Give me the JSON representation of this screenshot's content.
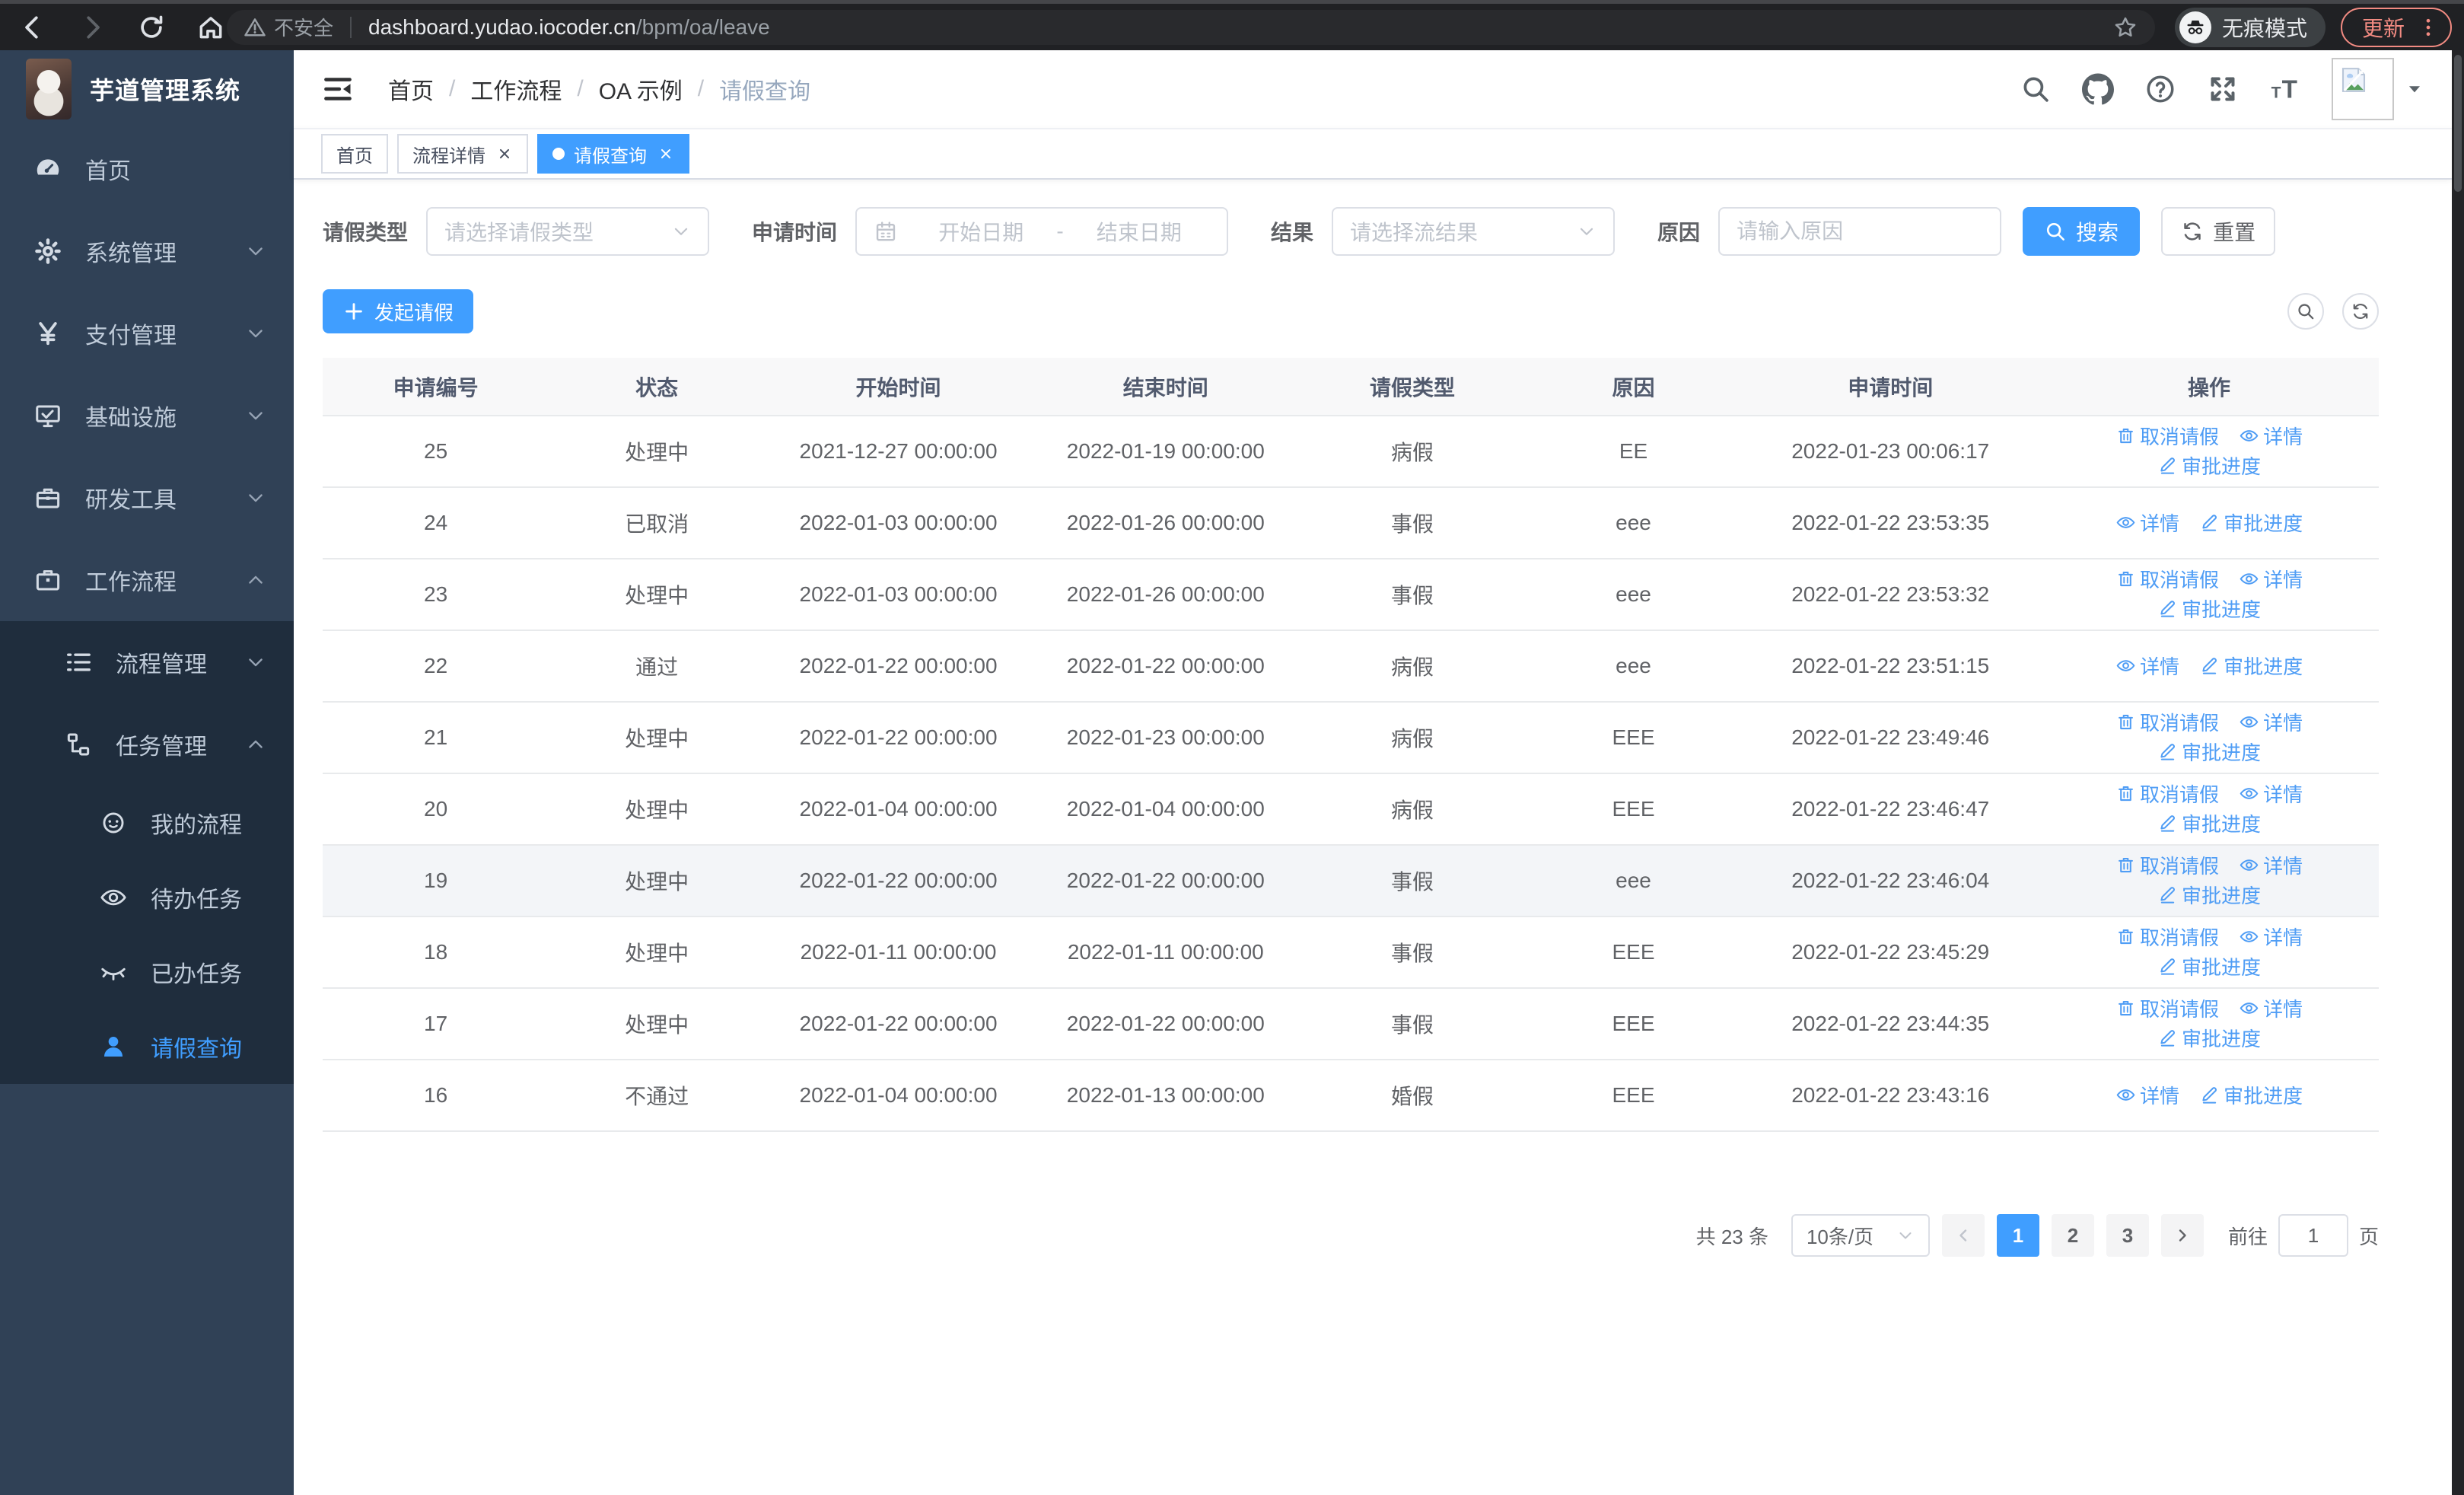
{
  "browser": {
    "security_label": "不安全",
    "url_host": "dashboard.yudao.iocoder.cn",
    "url_path": "/bpm/oa/leave",
    "incognito_label": "无痕模式",
    "update_label": "更新"
  },
  "sidebar": {
    "logo_title": "芋道管理系统",
    "menu": [
      {
        "label": "首页",
        "icon": "dashboard-icon",
        "level": 0
      },
      {
        "label": "系统管理",
        "icon": "gear-icon",
        "level": 0,
        "arrow": "down"
      },
      {
        "label": "支付管理",
        "icon": "yen-icon",
        "level": 0,
        "arrow": "down"
      },
      {
        "label": "基础设施",
        "icon": "monitor-icon",
        "level": 0,
        "arrow": "down"
      },
      {
        "label": "研发工具",
        "icon": "toolbox-icon",
        "level": 0,
        "arrow": "down"
      },
      {
        "label": "工作流程",
        "icon": "briefcase-icon",
        "level": 0,
        "arrow": "up"
      },
      {
        "label": "流程管理",
        "icon": "list-icon",
        "level": 1,
        "arrow": "down",
        "sub": true
      },
      {
        "label": "任务管理",
        "icon": "tree-icon",
        "level": 1,
        "arrow": "up",
        "sub": true
      },
      {
        "label": "我的流程",
        "icon": "face-icon",
        "level": 2,
        "sub": true
      },
      {
        "label": "待办任务",
        "icon": "eye-icon",
        "level": 2,
        "sub": true
      },
      {
        "label": "已办任务",
        "icon": "eye-closed-icon",
        "level": 2,
        "sub": true
      },
      {
        "label": "请假查询",
        "icon": "user-icon",
        "level": 2,
        "sub": true,
        "active": true
      }
    ]
  },
  "header": {
    "breadcrumb": [
      "首页",
      "工作流程",
      "OA 示例",
      "请假查询"
    ]
  },
  "tabs": [
    {
      "label": "首页",
      "closable": false,
      "active": false
    },
    {
      "label": "流程详情",
      "closable": true,
      "active": false
    },
    {
      "label": "请假查询",
      "closable": true,
      "active": true
    }
  ],
  "filters": {
    "leave_type_label": "请假类型",
    "leave_type_placeholder": "请选择请假类型",
    "apply_time_label": "申请时间",
    "start_date_placeholder": "开始日期",
    "range_separator": "-",
    "end_date_placeholder": "结束日期",
    "result_label": "结果",
    "result_placeholder": "请选择流结果",
    "reason_label": "原因",
    "reason_placeholder": "请输入原因",
    "search_button": "搜索",
    "reset_button": "重置"
  },
  "toolbar": {
    "create_button": "发起请假"
  },
  "table": {
    "columns": [
      "申请编号",
      "状态",
      "开始时间",
      "结束时间",
      "请假类型",
      "原因",
      "申请时间",
      "操作"
    ],
    "action_labels": {
      "cancel": "取消请假",
      "detail": "详情",
      "progress": "审批进度"
    },
    "rows": [
      {
        "id": "25",
        "status": "处理中",
        "start": "2021-12-27 00:00:00",
        "end": "2022-01-19 00:00:00",
        "type": "病假",
        "reason": "EE",
        "applied": "2022-01-23 00:06:17",
        "actions": [
          "cancel",
          "detail",
          "progress"
        ]
      },
      {
        "id": "24",
        "status": "已取消",
        "start": "2022-01-03 00:00:00",
        "end": "2022-01-26 00:00:00",
        "type": "事假",
        "reason": "eee",
        "applied": "2022-01-22 23:53:35",
        "actions": [
          "detail",
          "progress"
        ]
      },
      {
        "id": "23",
        "status": "处理中",
        "start": "2022-01-03 00:00:00",
        "end": "2022-01-26 00:00:00",
        "type": "事假",
        "reason": "eee",
        "applied": "2022-01-22 23:53:32",
        "actions": [
          "cancel",
          "detail",
          "progress"
        ]
      },
      {
        "id": "22",
        "status": "通过",
        "start": "2022-01-22 00:00:00",
        "end": "2022-01-22 00:00:00",
        "type": "病假",
        "reason": "eee",
        "applied": "2022-01-22 23:51:15",
        "actions": [
          "detail",
          "progress"
        ]
      },
      {
        "id": "21",
        "status": "处理中",
        "start": "2022-01-22 00:00:00",
        "end": "2022-01-23 00:00:00",
        "type": "病假",
        "reason": "EEE",
        "applied": "2022-01-22 23:49:46",
        "actions": [
          "cancel",
          "detail",
          "progress"
        ]
      },
      {
        "id": "20",
        "status": "处理中",
        "start": "2022-01-04 00:00:00",
        "end": "2022-01-04 00:00:00",
        "type": "病假",
        "reason": "EEE",
        "applied": "2022-01-22 23:46:47",
        "actions": [
          "cancel",
          "detail",
          "progress"
        ]
      },
      {
        "id": "19",
        "status": "处理中",
        "start": "2022-01-22 00:00:00",
        "end": "2022-01-22 00:00:00",
        "type": "事假",
        "reason": "eee",
        "applied": "2022-01-22 23:46:04",
        "actions": [
          "cancel",
          "detail",
          "progress"
        ],
        "highlighted": true
      },
      {
        "id": "18",
        "status": "处理中",
        "start": "2022-01-11 00:00:00",
        "end": "2022-01-11 00:00:00",
        "type": "事假",
        "reason": "EEE",
        "applied": "2022-01-22 23:45:29",
        "actions": [
          "cancel",
          "detail",
          "progress"
        ]
      },
      {
        "id": "17",
        "status": "处理中",
        "start": "2022-01-22 00:00:00",
        "end": "2022-01-22 00:00:00",
        "type": "事假",
        "reason": "EEE",
        "applied": "2022-01-22 23:44:35",
        "actions": [
          "cancel",
          "detail",
          "progress"
        ]
      },
      {
        "id": "16",
        "status": "不通过",
        "start": "2022-01-04 00:00:00",
        "end": "2022-01-13 00:00:00",
        "type": "婚假",
        "reason": "EEE",
        "applied": "2022-01-22 23:43:16",
        "actions": [
          "detail",
          "progress"
        ]
      }
    ]
  },
  "pagination": {
    "total_label": "共 23 条",
    "page_size": "10条/页",
    "pages": [
      "1",
      "2",
      "3"
    ],
    "active_page": "1",
    "goto_label": "前往",
    "goto_value": "1",
    "page_suffix": "页"
  },
  "colors": {
    "primary": "#409eff",
    "sidebar_bg": "#304156",
    "sidebar_submenu_bg": "#1f2d3d",
    "update_accent": "#f28b82",
    "table_header_bg": "#f8f8f9",
    "link_blue": "#4f9df5"
  }
}
